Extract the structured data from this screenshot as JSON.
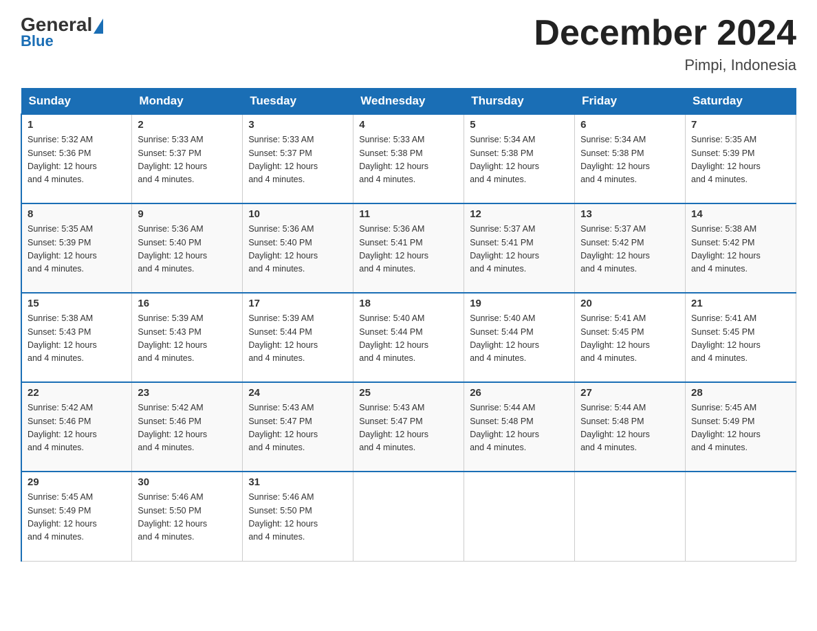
{
  "header": {
    "logo_general": "General",
    "logo_blue": "Blue",
    "month_title": "December 2024",
    "location": "Pimpi, Indonesia"
  },
  "days_of_week": [
    "Sunday",
    "Monday",
    "Tuesday",
    "Wednesday",
    "Thursday",
    "Friday",
    "Saturday"
  ],
  "weeks": [
    [
      {
        "day": "1",
        "sunrise": "5:32 AM",
        "sunset": "5:36 PM",
        "daylight": "12 hours and 4 minutes."
      },
      {
        "day": "2",
        "sunrise": "5:33 AM",
        "sunset": "5:37 PM",
        "daylight": "12 hours and 4 minutes."
      },
      {
        "day": "3",
        "sunrise": "5:33 AM",
        "sunset": "5:37 PM",
        "daylight": "12 hours and 4 minutes."
      },
      {
        "day": "4",
        "sunrise": "5:33 AM",
        "sunset": "5:38 PM",
        "daylight": "12 hours and 4 minutes."
      },
      {
        "day": "5",
        "sunrise": "5:34 AM",
        "sunset": "5:38 PM",
        "daylight": "12 hours and 4 minutes."
      },
      {
        "day": "6",
        "sunrise": "5:34 AM",
        "sunset": "5:38 PM",
        "daylight": "12 hours and 4 minutes."
      },
      {
        "day": "7",
        "sunrise": "5:35 AM",
        "sunset": "5:39 PM",
        "daylight": "12 hours and 4 minutes."
      }
    ],
    [
      {
        "day": "8",
        "sunrise": "5:35 AM",
        "sunset": "5:39 PM",
        "daylight": "12 hours and 4 minutes."
      },
      {
        "day": "9",
        "sunrise": "5:36 AM",
        "sunset": "5:40 PM",
        "daylight": "12 hours and 4 minutes."
      },
      {
        "day": "10",
        "sunrise": "5:36 AM",
        "sunset": "5:40 PM",
        "daylight": "12 hours and 4 minutes."
      },
      {
        "day": "11",
        "sunrise": "5:36 AM",
        "sunset": "5:41 PM",
        "daylight": "12 hours and 4 minutes."
      },
      {
        "day": "12",
        "sunrise": "5:37 AM",
        "sunset": "5:41 PM",
        "daylight": "12 hours and 4 minutes."
      },
      {
        "day": "13",
        "sunrise": "5:37 AM",
        "sunset": "5:42 PM",
        "daylight": "12 hours and 4 minutes."
      },
      {
        "day": "14",
        "sunrise": "5:38 AM",
        "sunset": "5:42 PM",
        "daylight": "12 hours and 4 minutes."
      }
    ],
    [
      {
        "day": "15",
        "sunrise": "5:38 AM",
        "sunset": "5:43 PM",
        "daylight": "12 hours and 4 minutes."
      },
      {
        "day": "16",
        "sunrise": "5:39 AM",
        "sunset": "5:43 PM",
        "daylight": "12 hours and 4 minutes."
      },
      {
        "day": "17",
        "sunrise": "5:39 AM",
        "sunset": "5:44 PM",
        "daylight": "12 hours and 4 minutes."
      },
      {
        "day": "18",
        "sunrise": "5:40 AM",
        "sunset": "5:44 PM",
        "daylight": "12 hours and 4 minutes."
      },
      {
        "day": "19",
        "sunrise": "5:40 AM",
        "sunset": "5:44 PM",
        "daylight": "12 hours and 4 minutes."
      },
      {
        "day": "20",
        "sunrise": "5:41 AM",
        "sunset": "5:45 PM",
        "daylight": "12 hours and 4 minutes."
      },
      {
        "day": "21",
        "sunrise": "5:41 AM",
        "sunset": "5:45 PM",
        "daylight": "12 hours and 4 minutes."
      }
    ],
    [
      {
        "day": "22",
        "sunrise": "5:42 AM",
        "sunset": "5:46 PM",
        "daylight": "12 hours and 4 minutes."
      },
      {
        "day": "23",
        "sunrise": "5:42 AM",
        "sunset": "5:46 PM",
        "daylight": "12 hours and 4 minutes."
      },
      {
        "day": "24",
        "sunrise": "5:43 AM",
        "sunset": "5:47 PM",
        "daylight": "12 hours and 4 minutes."
      },
      {
        "day": "25",
        "sunrise": "5:43 AM",
        "sunset": "5:47 PM",
        "daylight": "12 hours and 4 minutes."
      },
      {
        "day": "26",
        "sunrise": "5:44 AM",
        "sunset": "5:48 PM",
        "daylight": "12 hours and 4 minutes."
      },
      {
        "day": "27",
        "sunrise": "5:44 AM",
        "sunset": "5:48 PM",
        "daylight": "12 hours and 4 minutes."
      },
      {
        "day": "28",
        "sunrise": "5:45 AM",
        "sunset": "5:49 PM",
        "daylight": "12 hours and 4 minutes."
      }
    ],
    [
      {
        "day": "29",
        "sunrise": "5:45 AM",
        "sunset": "5:49 PM",
        "daylight": "12 hours and 4 minutes."
      },
      {
        "day": "30",
        "sunrise": "5:46 AM",
        "sunset": "5:50 PM",
        "daylight": "12 hours and 4 minutes."
      },
      {
        "day": "31",
        "sunrise": "5:46 AM",
        "sunset": "5:50 PM",
        "daylight": "12 hours and 4 minutes."
      },
      null,
      null,
      null,
      null
    ]
  ],
  "labels": {
    "sunrise": "Sunrise:",
    "sunset": "Sunset:",
    "daylight": "Daylight: 12 hours"
  }
}
